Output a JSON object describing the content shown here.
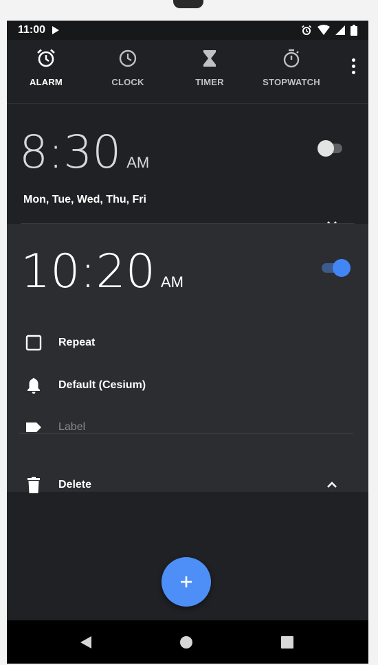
{
  "status_bar": {
    "time": "11:00"
  },
  "tabs": [
    {
      "label": "ALARM",
      "icon": "alarm-icon",
      "active": true
    },
    {
      "label": "CLOCK",
      "icon": "clock-icon",
      "active": false
    },
    {
      "label": "TIMER",
      "icon": "hourglass-icon",
      "active": false
    },
    {
      "label": "STOPWATCH",
      "icon": "stopwatch-icon",
      "active": false
    }
  ],
  "alarms": [
    {
      "time": "8:30",
      "period": "AM",
      "enabled": false,
      "days": "Mon, Tue, Wed, Thu, Fri",
      "expanded": false
    },
    {
      "time": "10:20",
      "period": "AM",
      "enabled": true,
      "expanded": true,
      "repeat_label": "Repeat",
      "repeat_checked": false,
      "ringtone": "Default (Cesium)",
      "label_placeholder": "Label",
      "delete_label": "Delete"
    }
  ],
  "colors": {
    "accent": "#4285f4",
    "background": "#202124",
    "expanded_card": "#2c2d31"
  },
  "fab": {
    "icon": "plus-icon"
  },
  "nav_bar": [
    "back-icon",
    "home-icon",
    "recents-icon"
  ]
}
